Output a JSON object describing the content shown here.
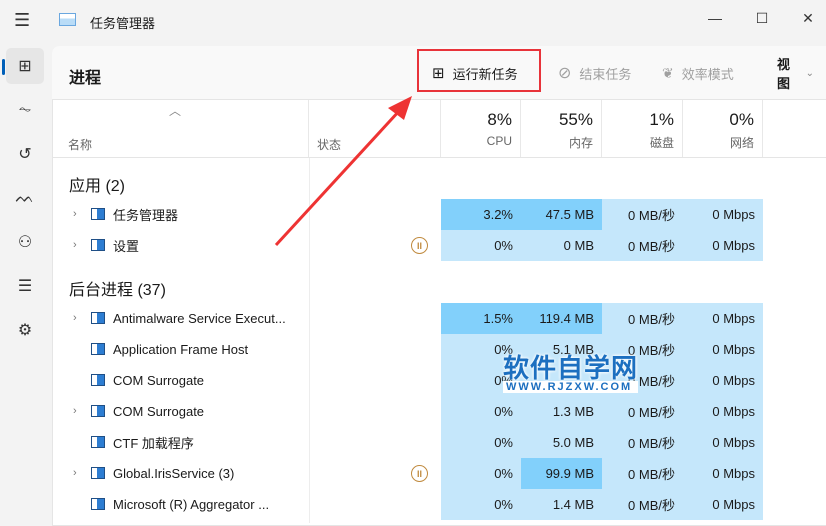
{
  "app": {
    "title": "任务管理器",
    "window_controls": {
      "minimize": "—",
      "maximize": "☐",
      "close": "✕"
    }
  },
  "sidebar": {
    "items": [
      {
        "name": "processes",
        "icon": "⊞"
      },
      {
        "name": "performance",
        "icon": "⏦"
      },
      {
        "name": "app-history",
        "icon": "↺"
      },
      {
        "name": "startup-apps",
        "icon": "ᨓ"
      },
      {
        "name": "users",
        "icon": "⚇"
      },
      {
        "name": "details",
        "icon": "☰"
      },
      {
        "name": "services",
        "icon": "⚙"
      }
    ]
  },
  "toolbar": {
    "title": "进程",
    "run_new_task": "运行新任务",
    "end_task": "结束任务",
    "efficiency_mode": "效率模式",
    "view": "视图"
  },
  "columns": {
    "name": "名称",
    "status": "状态",
    "cpu": {
      "pct": "8%",
      "label": "CPU"
    },
    "memory": {
      "pct": "55%",
      "label": "内存"
    },
    "disk": {
      "pct": "1%",
      "label": "磁盘"
    },
    "network": {
      "pct": "0%",
      "label": "网络"
    }
  },
  "groups": {
    "apps": "应用 (2)",
    "background": "后台进程 (37)"
  },
  "apps": [
    {
      "name": "任务管理器",
      "cpu": "3.2%",
      "mem": "47.5 MB",
      "disk": "0 MB/秒",
      "net": "0 Mbps",
      "hot": [
        "cpu",
        "mem"
      ],
      "expand": true
    },
    {
      "name": "设置",
      "cpu": "0%",
      "mem": "0 MB",
      "disk": "0 MB/秒",
      "net": "0 Mbps",
      "suspended": true,
      "expand": true
    }
  ],
  "background": [
    {
      "name": "Antimalware Service Execut...",
      "cpu": "1.5%",
      "mem": "119.4 MB",
      "disk": "0 MB/秒",
      "net": "0 Mbps",
      "hot": [
        "cpu",
        "mem"
      ],
      "expand": true
    },
    {
      "name": "Application Frame Host",
      "cpu": "0%",
      "mem": "5.1 MB",
      "disk": "0 MB/秒",
      "net": "0 Mbps"
    },
    {
      "name": "COM Surrogate",
      "cpu": "0%",
      "mem": "",
      "disk": "0 MB/秒",
      "net": "0 Mbps"
    },
    {
      "name": "COM Surrogate",
      "cpu": "0%",
      "mem": "1.3 MB",
      "disk": "0 MB/秒",
      "net": "0 Mbps",
      "expand": true
    },
    {
      "name": "CTF 加载程序",
      "cpu": "0%",
      "mem": "5.0 MB",
      "disk": "0 MB/秒",
      "net": "0 Mbps"
    },
    {
      "name": "Global.IrisService (3)",
      "cpu": "0%",
      "mem": "99.9 MB",
      "disk": "0 MB/秒",
      "net": "0 Mbps",
      "hot": [
        "mem"
      ],
      "suspended": true,
      "expand": true
    },
    {
      "name": "Microsoft (R) Aggregator ...",
      "cpu": "0%",
      "mem": "1.4 MB",
      "disk": "0 MB/秒",
      "net": "0 Mbps"
    }
  ],
  "watermark": {
    "title": "软件自学网",
    "url": "WWW.RJZXW.COM"
  },
  "colors": {
    "highlight": "#e8333a",
    "cell_light": "#c5e7fb",
    "cell_hot": "#82d0fb",
    "accent": "#005fb8"
  }
}
